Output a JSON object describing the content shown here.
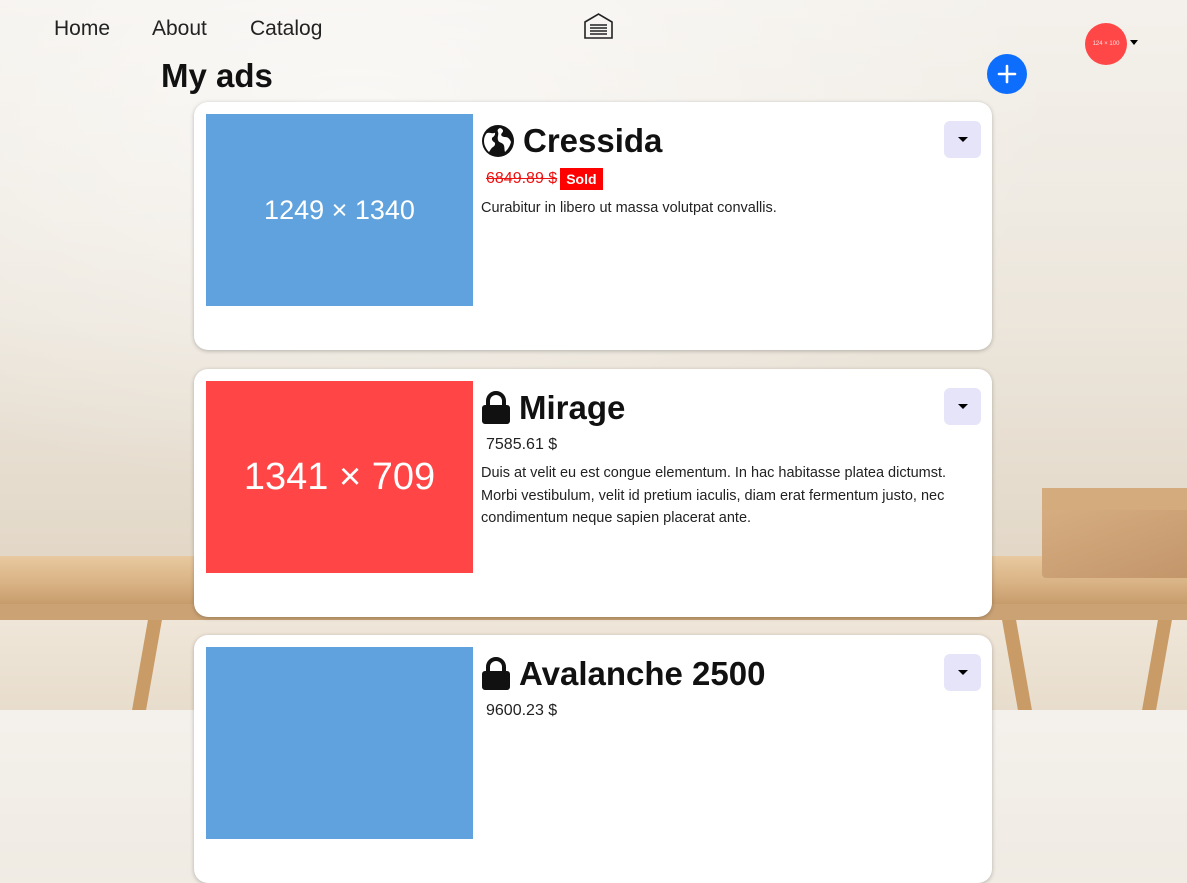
{
  "nav": {
    "links": [
      "Home",
      "About",
      "Catalog"
    ],
    "logo_icon": "building-icon",
    "avatar_text": "124 × 100",
    "avatar_color": "#ff4747"
  },
  "page": {
    "title": "My ads",
    "add_icon": "plus-icon",
    "add_color": "#0d6efd"
  },
  "ads": [
    {
      "title": "Cressida",
      "visibility_icon": "globe-icon",
      "price": "6849.89 $",
      "sold": true,
      "sold_label": "Sold",
      "description": "Curabitur in libero ut massa volutpat convallis.",
      "image_label": "1249 × 1340",
      "image_color": "#5fa2dd"
    },
    {
      "title": "Mirage",
      "visibility_icon": "lock-icon",
      "price": "7585.61 $",
      "sold": false,
      "description": "Duis at velit eu est congue elementum. In hac habitasse platea dictumst. Morbi vestibulum, velit id pretium iaculis, diam erat fermentum justo, nec condimentum neque sapien placerat ante.",
      "image_label": "1341 × 709",
      "image_color": "#ff4545"
    },
    {
      "title": "Avalanche 2500",
      "visibility_icon": "lock-icon",
      "price": "9600.23 $",
      "sold": false,
      "description": "",
      "image_label": "",
      "image_color": "#5fa2dd"
    }
  ]
}
